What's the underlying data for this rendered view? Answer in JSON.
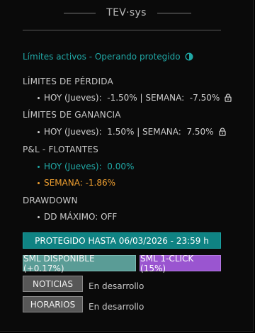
{
  "header": {
    "title": "TEV·sys"
  },
  "status": {
    "text": "Límites activos - Operando protegido"
  },
  "loss_limits": {
    "heading": "LÍMITES DE PÉRDIDA",
    "line": "HOY (Jueves):  -1.50% | SEMANA:  -7.50%"
  },
  "gain_limits": {
    "heading": "LÍMITES DE GANANCIA",
    "line": "HOY (Jueves):  1.50% | SEMANA:  7.50%"
  },
  "pnl": {
    "heading": "P&L - FLOTANTES",
    "today": "HOY (Jueves):  0.00%",
    "week": "SEMANA: -1.86%"
  },
  "drawdown": {
    "heading": "DRAWDOWN",
    "line": "DD MÁXIMO: OFF"
  },
  "protection": {
    "label": "PROTEGIDO HASTA 06/03/2026 - 23:59 h"
  },
  "buttons": {
    "sml_available": "SML DISPONIBLE (+0.17%)",
    "sml_one_click": "SML 1-CLICK (15%)",
    "news": "NOTICIAS",
    "news_status": "En desarrollo",
    "schedules": "HORARIOS",
    "schedules_status": "En desarrollo"
  },
  "colors": {
    "teal": "#20a8a6",
    "orange": "#f0a030",
    "protect_bar": "#0f8383",
    "sml_available": "#5a9c96",
    "sml_one_click": "#9a55d0",
    "gray_button": "#575757"
  },
  "icons": {
    "status": "shield-icon",
    "loss_lock": "lock-icon",
    "gain_lock": "lock-icon"
  }
}
